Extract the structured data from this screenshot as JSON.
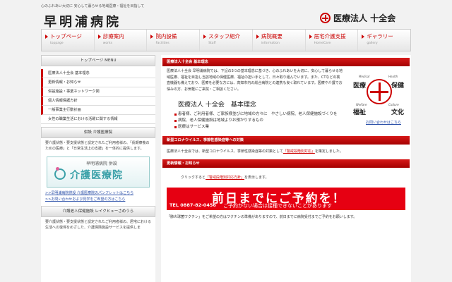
{
  "header": {
    "tagline": "心のふれあい大切に 安心して暮らせる地域医療・福祉を目指して",
    "logo": "早明浦病院",
    "corporation": "医療法人 十全会"
  },
  "nav": [
    {
      "label": "トップページ",
      "sub": "toppage"
    },
    {
      "label": "診療案内",
      "sub": "works"
    },
    {
      "label": "院内設備",
      "sub": "Facilities"
    },
    {
      "label": "スタッフ紹介",
      "sub": "Staff"
    },
    {
      "label": "病院概要",
      "sub": "information"
    },
    {
      "label": "居宅介護支援",
      "sub": "HomeCare"
    },
    {
      "label": "ギャラリー",
      "sub": "gallery"
    }
  ],
  "sidebar": {
    "menu_title": "トップページ MENU",
    "items": [
      "医療法人十全会 基本理念",
      "更新情報・お知らせ",
      "併設施設・事業ネットワーク図",
      "個人情報保護方針",
      "一般事業主行動計画"
    ],
    "sub_item": "女性の職業生活における活躍に関する情報",
    "facility_title": "併設 介護医療院",
    "facility_text": "要介護状態・要支援状態と認定されたご利用者様の、「長期療養のための医療」と「日常生活上の支援」を一体的に提供します。",
    "banner_top": "早明浦病院 併設",
    "banner_main": "介護医療院",
    "link1": ">>早明浦病院併設 介護医療院のパンフレットはこちら",
    "link2": ">>お問い合わせおよび見学をご希望の方はこちら",
    "rouken_title": "介護老人保健施設 レイクヒューさめうら",
    "rouken_text": "要介護状態・要支援状態と認定されたご利用者様の、居宅における生活への復帰をめざした、介護保険施設サービスを提供しま"
  },
  "main": {
    "section1_title": "医療法人十全会 基本理念",
    "intro": "医療法人十全会 早明浦病院では、下記の3つの基本理念に基づき、心のふれあいを大切に、安心して暮らせる地域医療、福祉を目指し当該地域の保健医療、福祉の担い手として、日々取り組んでいます。また、CTなどの検査機器も備えており、医療を必要な方には、高知市内の総合病院との連携も良く取れています。医療や介護でお悩みの方、お気軽にご来院・ご相談ください。",
    "emblem": {
      "medical_en": "Medical",
      "health_en": "Health",
      "welfare_en": "Welfare",
      "culture_en": "Culture",
      "medical_jp": "医療",
      "health_jp": "保健",
      "welfare_jp": "福祉",
      "culture_jp": "文化"
    },
    "inquiry_link": "お問い合わせはこちら",
    "philosophy_title": "医療法人 十全会　基本理念",
    "bullets": [
      "患者様、ご利用者様、ご家族様並びに地域の方々に　やさしい病院、老人保健施設づくりを",
      "病院、老人保健施設は地域よりお預かりするもの",
      "医療はサービス業"
    ],
    "section2_title": "新型コロナウイルス、季節性感染症等への対策",
    "section2_text_before": "医療法人十全会では、新型コロナウイルス、季節性感染症等の対策として",
    "section2_highlight": "「警戒段階別対応」",
    "section2_text_after": "を策定しました。",
    "section3_title": "更新情報・お知らせ",
    "update_before": "クリックすると",
    "update_link": "「警戒段階別対応方針」",
    "update_after": "を表示します。",
    "reservation_main": "前日までにご予約を！",
    "reservation_tel": "TEL 0887-82-0456",
    "reservation_note": "ご予約がない場合は接種できないことがあります",
    "vaccine_text": "「肺炎球菌ワクチン」をご希望の方はワクチンの準備がありますので、前日までに病院受付までご予約をお願いします。"
  }
}
